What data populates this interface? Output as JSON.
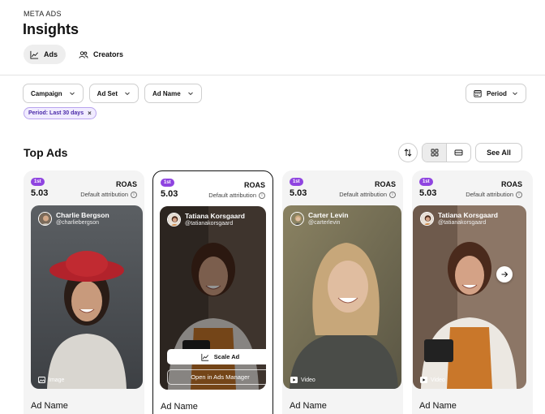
{
  "header": {
    "eyebrow": "META ADS",
    "title": "Insights"
  },
  "tabs": [
    {
      "label": "Ads",
      "icon": "line-chart-icon",
      "active": true
    },
    {
      "label": "Creators",
      "icon": "users-icon",
      "active": false
    }
  ],
  "filters": [
    {
      "label": "Campaign"
    },
    {
      "label": "Ad Set"
    },
    {
      "label": "Ad Name"
    }
  ],
  "period": {
    "label": "Period",
    "icon": "calendar-icon"
  },
  "active_chip": {
    "label": "Period: Last 30 days",
    "remove": "×"
  },
  "section": {
    "title": "Top Ads",
    "see_all": "See All"
  },
  "colors": {
    "accent": "#8f44e0",
    "chip_bg": "#f1ecff",
    "chip_border": "#b9a4ee",
    "card_bg": "#f4f4f4"
  },
  "cards": [
    {
      "rank": "1st",
      "metric_label": "ROAS",
      "metric_value": "5.03",
      "attribution": "Default attribution",
      "info": "i",
      "creator_name": "Charlie Bergson",
      "creator_handle": "@charliebergson",
      "media_type": "Image",
      "media_icon": "image-icon",
      "ad_name": "Ad Name"
    },
    {
      "rank": "1st",
      "metric_label": "ROAS",
      "metric_value": "5.03",
      "attribution": "Default attribution",
      "info": "i",
      "creator_name": "Tatiana Korsgaard",
      "creator_handle": "@tatianakorsgaard",
      "scale_label": "Scale Ad",
      "open_label": "Open in Ads Manager",
      "ad_name": "Ad Name"
    },
    {
      "rank": "1st",
      "metric_label": "ROAS",
      "metric_value": "5.03",
      "attribution": "Default attribution",
      "info": "i",
      "creator_name": "Carter Levin",
      "creator_handle": "@carterlevin",
      "media_type": "Video",
      "media_icon": "play-icon",
      "ad_name": "Ad Name"
    },
    {
      "rank": "1st",
      "metric_label": "ROAS",
      "metric_value": "5.03",
      "attribution": "Default attribution",
      "info": "i",
      "creator_name": "Tatiana Korsgaard",
      "creator_handle": "@tatianakorsgaard",
      "media_type": "Video",
      "media_icon": "play-icon",
      "ad_name": "Ad Name"
    }
  ]
}
